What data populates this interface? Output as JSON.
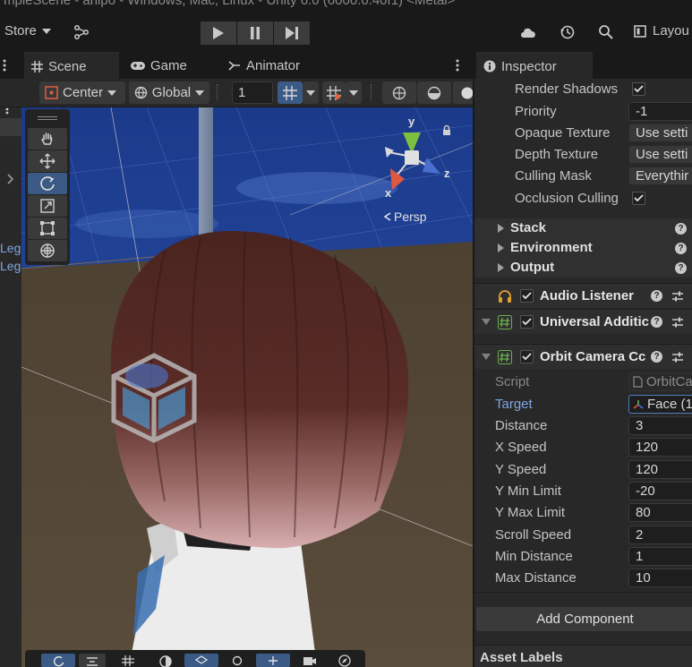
{
  "title_bar": {
    "text": "mpleScene - arlipo - Windows, Mac, Linux - Unity 6.0 (6000.0.40f1) <Metal>"
  },
  "toolbar": {
    "store_label": "Store",
    "layout_label": "Layou",
    "icons": [
      "branch-icon",
      "play-icon",
      "pause-icon",
      "step-icon",
      "cloud-icon",
      "history-icon",
      "search-icon",
      "layout-icon"
    ]
  },
  "scene_tabs": [
    {
      "label": "Scene",
      "icon": "grid-icon"
    },
    {
      "label": "Game",
      "icon": "gamepad-icon"
    },
    {
      "label": "Animator",
      "icon": "animator-icon"
    }
  ],
  "scene_toolbar": {
    "pivot": "Center",
    "space": "Global",
    "grid_size": "1"
  },
  "left_panel": {
    "items": [
      "Leg",
      "Leg"
    ]
  },
  "gizmo": {
    "y": "y",
    "x": "x",
    "z": "z",
    "projection": "Persp"
  },
  "inspector": {
    "tab_label": "Inspector",
    "camera_props": [
      {
        "label": "Render Shadows",
        "type": "checkbox",
        "checked": true
      },
      {
        "label": "Priority",
        "type": "field",
        "value": "-1"
      },
      {
        "label": "Opaque Texture",
        "type": "dropdown",
        "value": "Use setti"
      },
      {
        "label": "Depth Texture",
        "type": "dropdown",
        "value": "Use setti"
      },
      {
        "label": "Culling Mask",
        "type": "dropdown",
        "value": "Everythir"
      },
      {
        "label": "Occlusion Culling",
        "type": "checkbox",
        "checked": true
      }
    ],
    "sections": [
      "Stack",
      "Environment",
      "Output"
    ],
    "components": [
      {
        "name": "Audio Listener",
        "icon": "headphones-icon",
        "enabled": true
      },
      {
        "name": "Universal Additic",
        "icon": "script-icon",
        "enabled": true
      },
      {
        "name": "Orbit Camera Cc",
        "icon": "script-icon",
        "enabled": true
      }
    ],
    "orbit_props": [
      {
        "label": "Script",
        "value": "OrbitCa",
        "muted": true
      },
      {
        "label": "Target",
        "value": "Face (1",
        "link": true
      },
      {
        "label": "Distance",
        "value": "3"
      },
      {
        "label": "X Speed",
        "value": "120"
      },
      {
        "label": "Y Speed",
        "value": "120"
      },
      {
        "label": "Y Min Limit",
        "value": "-20"
      },
      {
        "label": "Y Max Limit",
        "value": "80"
      },
      {
        "label": "Scroll Speed",
        "value": "2"
      },
      {
        "label": "Min Distance",
        "value": "1"
      },
      {
        "label": "Max Distance",
        "value": "10"
      }
    ],
    "add_component_label": "Add Component",
    "asset_labels": "Asset Labels"
  },
  "colors": {
    "accent": "#4c7fc0",
    "link": "#7fa7e0",
    "panel": "#282828",
    "background": "#191919"
  }
}
